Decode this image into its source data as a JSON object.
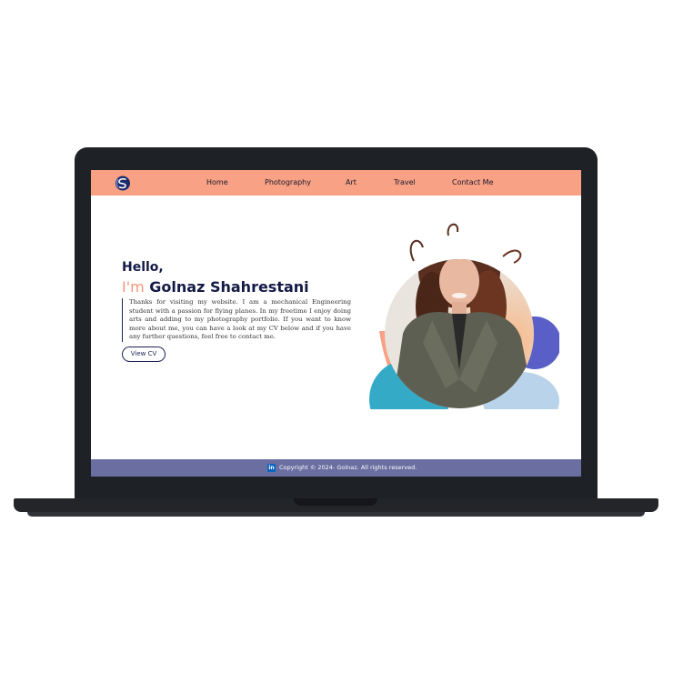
{
  "nav": {
    "items": [
      {
        "label": "Home"
      },
      {
        "label": "Photography"
      },
      {
        "label": "Art"
      },
      {
        "label": "Travel"
      },
      {
        "label": "Contact Me"
      }
    ]
  },
  "hero": {
    "greeting": "Hello,",
    "im_prefix": "I'm",
    "name": "Golnaz Shahrestani",
    "intro": "Thanks for visiting my website. I am a mechanical Engineering student with a passion for flying planes. In my freetime I enjoy doing arts and adding to my photography portfolio. If you want to know more about me, you can have a look at my CV below and if you have any further questions, feel free to contact me.",
    "cv_button": "View CV"
  },
  "footer": {
    "social_icon": "linkedin-icon",
    "copyright": "Copyright © 2024- Golnaz. All rights reserved."
  },
  "colors": {
    "navbar": "#f8a184",
    "accent_orange": "#f3967a",
    "navy": "#141a45",
    "footer": "#6a6ea1",
    "teal": "#35aac7",
    "light_blue": "#b8d3ea",
    "violet": "#5a5fc7",
    "laptop": "#1e2125"
  }
}
